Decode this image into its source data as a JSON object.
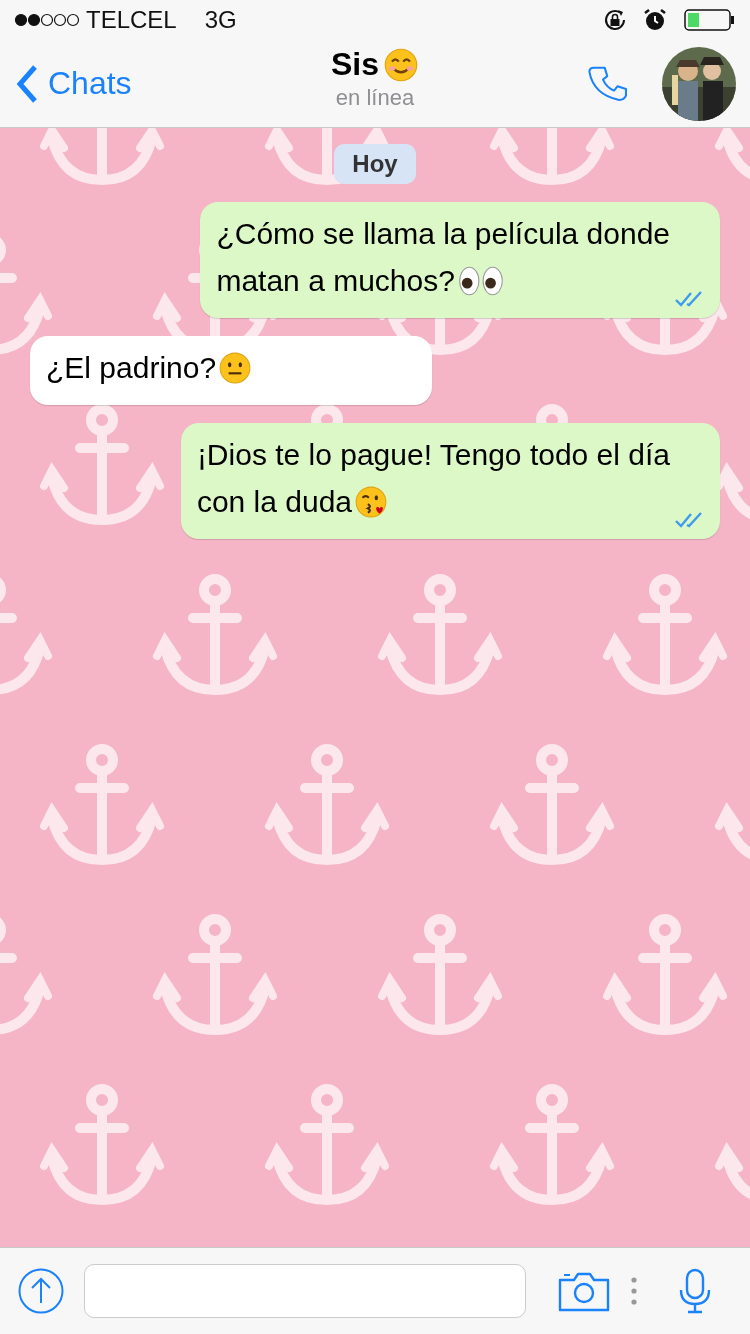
{
  "status_bar": {
    "carrier": "TELCEL",
    "network": "3G"
  },
  "header": {
    "back_label": "Chats",
    "contact_name": "Sis",
    "contact_emoji": {
      "kind": "smile"
    },
    "presence": "en línea"
  },
  "chat": {
    "day_badge": "Hoy",
    "messages": [
      {
        "kind": "out",
        "lines": [
          "¿Cómo se llama la película donde",
          "matan a muchos?"
        ],
        "emoji": {
          "kind": "eyes"
        },
        "read": true
      },
      {
        "kind": "in",
        "lines": [
          "¿El padrino? "
        ],
        "emoji": {
          "kind": "neutral"
        }
      },
      {
        "kind": "out",
        "lines": [
          "¡Dios te lo pague! Tengo todo el día",
          "con la duda"
        ],
        "emoji": {
          "kind": "kiss"
        },
        "read": true
      }
    ]
  }
}
